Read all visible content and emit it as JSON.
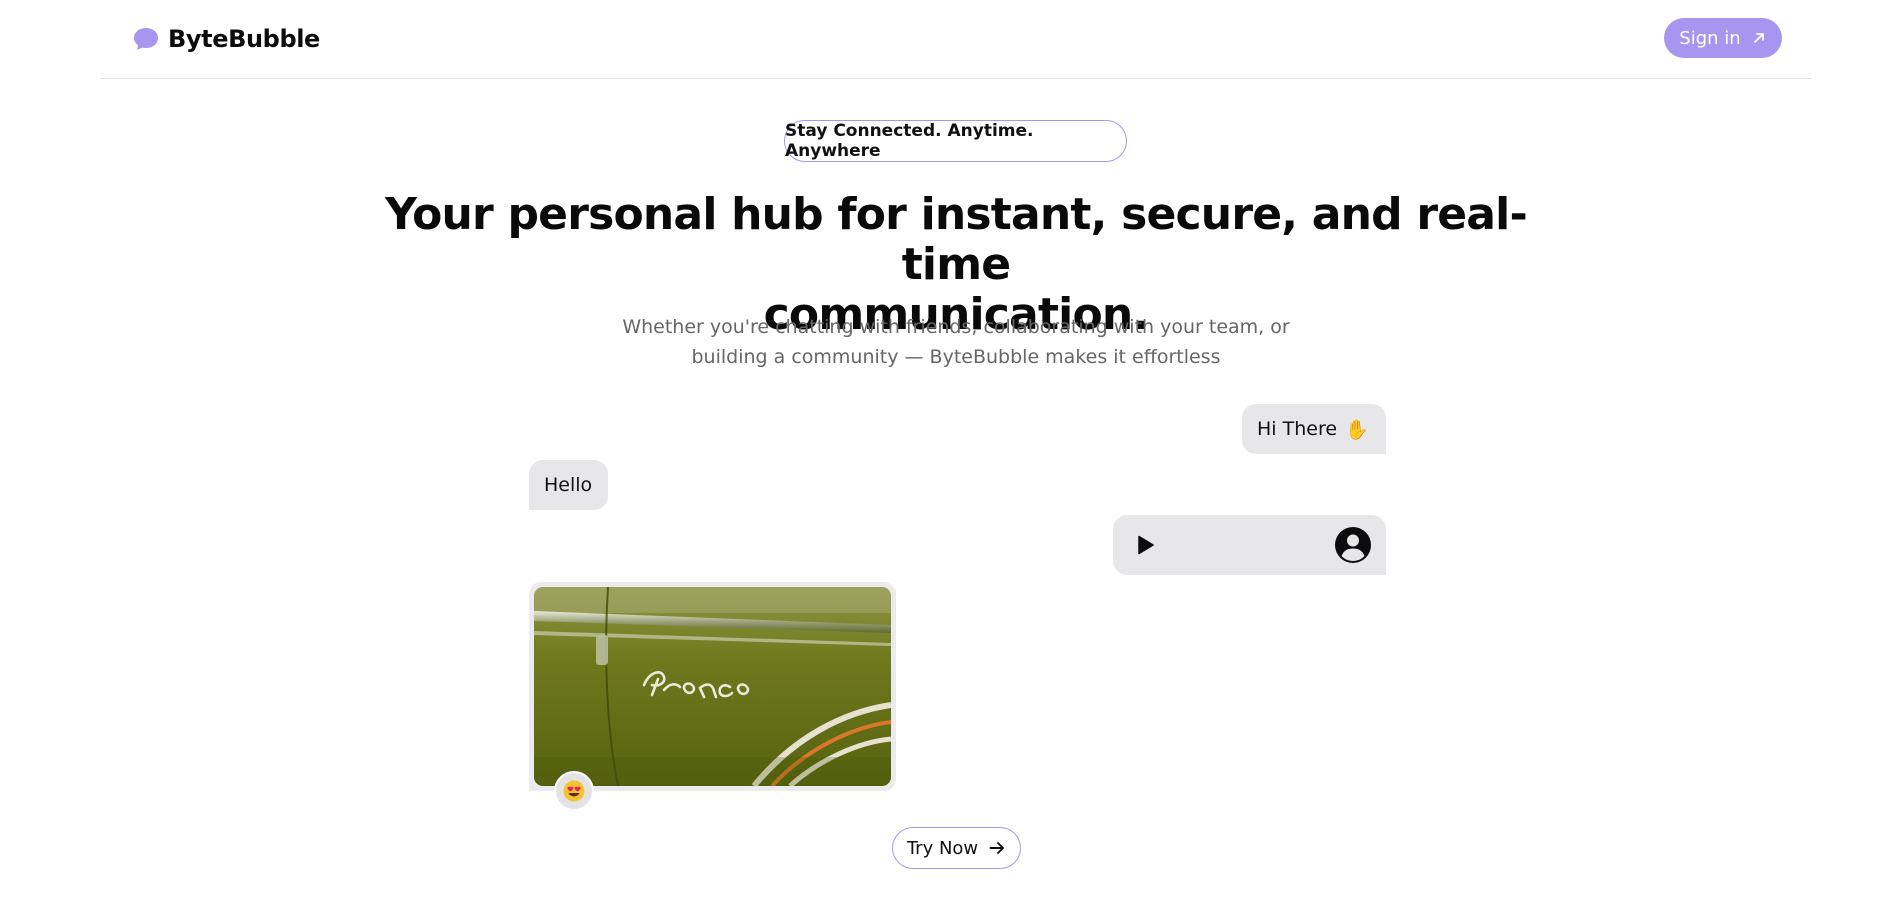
{
  "brand": {
    "name": "ByteBubble",
    "icon": "chat-bubble-icon",
    "accent_color": "#a796f0"
  },
  "header": {
    "signin_label": "Sign in",
    "signin_icon": "arrow-up-right-icon"
  },
  "hero": {
    "tagline": "Stay Connected. Anytime. Anywhere",
    "headline_line1": "Your personal hub for instant, secure, and real-time",
    "headline_line2": "communication.",
    "subtitle_line1": "Whether you're chatting with friends, collaborating with your team, or",
    "subtitle_line2": "building a community — ByteBubble makes it effortless"
  },
  "chat": {
    "message_outgoing_1": "Hi There",
    "message_outgoing_1_emoji": "✋",
    "message_incoming_1": "Hello",
    "voice_message": {
      "play_icon": "play-icon",
      "avatar_icon": "user-avatar-icon"
    },
    "image_message": {
      "image_alt": "Bronco",
      "reaction_icon": "heart-eyes-emoji-icon"
    }
  },
  "cta": {
    "label": "Try Now",
    "icon": "arrow-right-icon"
  }
}
